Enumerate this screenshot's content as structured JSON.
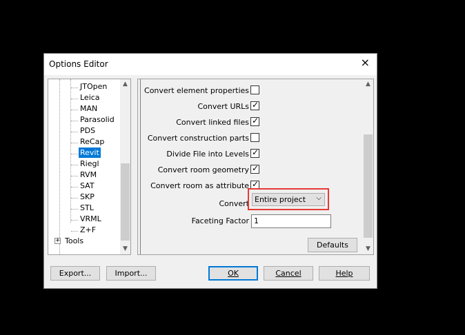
{
  "window": {
    "title": "Options Editor",
    "close_icon": "×"
  },
  "tree": {
    "items": [
      "JTOpen",
      "Leica",
      "MAN",
      "Parasolid",
      "PDS",
      "ReCap",
      "Revit",
      "Riegl",
      "RVM",
      "SAT",
      "SKP",
      "STL",
      "VRML",
      "Z+F"
    ],
    "selected": "Revit",
    "tools": "Tools",
    "expander": "+"
  },
  "panel": {
    "rows": [
      {
        "label": "Convert element properties",
        "checked": false
      },
      {
        "label": "Convert URLs",
        "checked": true
      },
      {
        "label": "Convert linked files",
        "checked": true
      },
      {
        "label": "Convert construction parts",
        "checked": false
      },
      {
        "label": "Divide File into Levels",
        "checked": true
      },
      {
        "label": "Convert room geometry",
        "checked": true
      },
      {
        "label": "Convert room as attribute",
        "checked": true
      }
    ],
    "convert_label": "Convert",
    "convert_value": "Entire project",
    "faceting_label": "Faceting Factor",
    "faceting_value": "1",
    "defaults_button": "Defaults"
  },
  "footer": {
    "export_button": "Export...",
    "import_button": "Import...",
    "ok_button": "OK",
    "cancel_button": "Cancel",
    "help_button": "Help"
  }
}
